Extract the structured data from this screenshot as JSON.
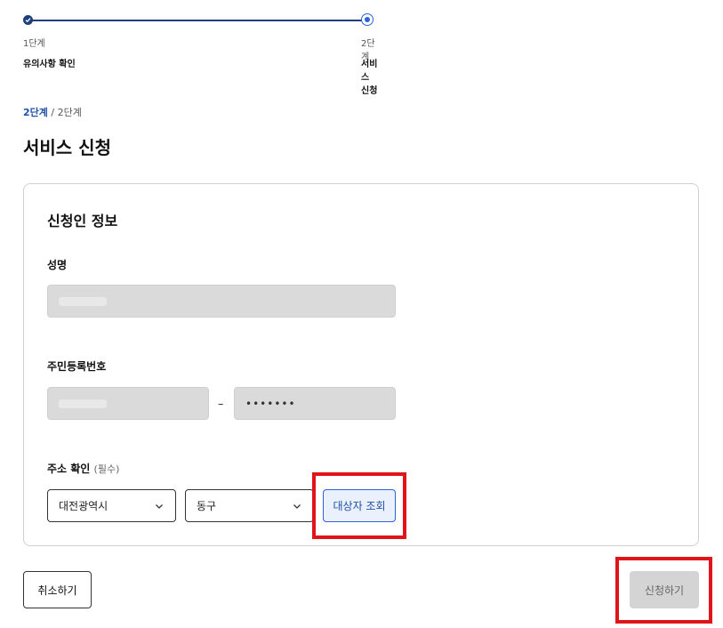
{
  "stepper": {
    "steps": [
      {
        "number": "1단계",
        "name": "유의사항 확인"
      },
      {
        "number": "2단계",
        "name": "서비스 신청"
      }
    ]
  },
  "progress": {
    "current": "2단계",
    "separator": " / ",
    "total": "2단계"
  },
  "page_title": "서비스 신청",
  "form": {
    "section_title": "신청인 정보",
    "name_label": "성명",
    "rrn_label": "주민등록번호",
    "rrn_dash": "–",
    "rrn_back_masked": "•••••••",
    "address_label": "주소 확인",
    "address_required": "(필수)",
    "city_select": "대전광역시",
    "district_select": "동구",
    "lookup_button": "대상자 조회"
  },
  "actions": {
    "cancel": "취소하기",
    "submit": "신청하기"
  },
  "colors": {
    "primary": "#1f4fa8",
    "accent": "#2d62d9",
    "highlight": "#e0151a",
    "disabled": "#d4d4d4"
  }
}
